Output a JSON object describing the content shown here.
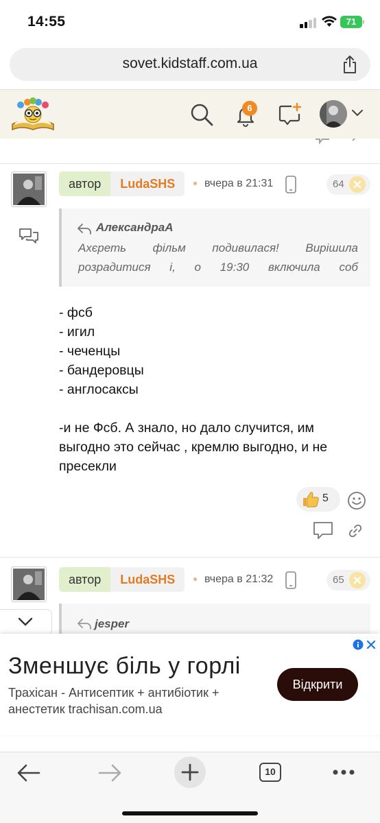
{
  "status_bar": {
    "time": "14:55",
    "battery": "71"
  },
  "browser": {
    "url": "sovet.kidstaff.com.ua"
  },
  "header": {
    "notifications_count": "6"
  },
  "posts": [
    {
      "author_label": "автор",
      "author_name": "LudaSHS",
      "time": "вчера в 21:31",
      "number": "64",
      "quote": {
        "author": "АлександраА",
        "lines": [
          "Ахєреть фільм подивилася! Вирішила",
          "розрадитися і, о 19:30 включила соб"
        ]
      },
      "body_lines": [
        "- фсб",
        "- игил",
        "- чеченцы",
        "- бандеровцы",
        "- англосаксы",
        "",
        "-и не Фсб. А знало, но дало случится, им",
        "выгодно это сейчас , кремлю выгодно, и не",
        "пресекли"
      ],
      "likes": "5"
    },
    {
      "author_label": "автор",
      "author_name": "LudaSHS",
      "time": "вчера в 21:32",
      "number": "65",
      "quote": {
        "author": "jesper"
      }
    }
  ],
  "ad": {
    "title": "Зменшує біль у горлі",
    "description_lines": [
      "Трахісан - Антисептик + антибіотик +",
      "анестетик trachisan.com.ua"
    ],
    "button": "Відкрити"
  },
  "toolbar": {
    "tabs_count": "10"
  },
  "colors": {
    "accent_orange": "#e27b22",
    "author_green": "#e2efcc",
    "ad_button": "#2a0c08",
    "battery": "#35c759"
  }
}
